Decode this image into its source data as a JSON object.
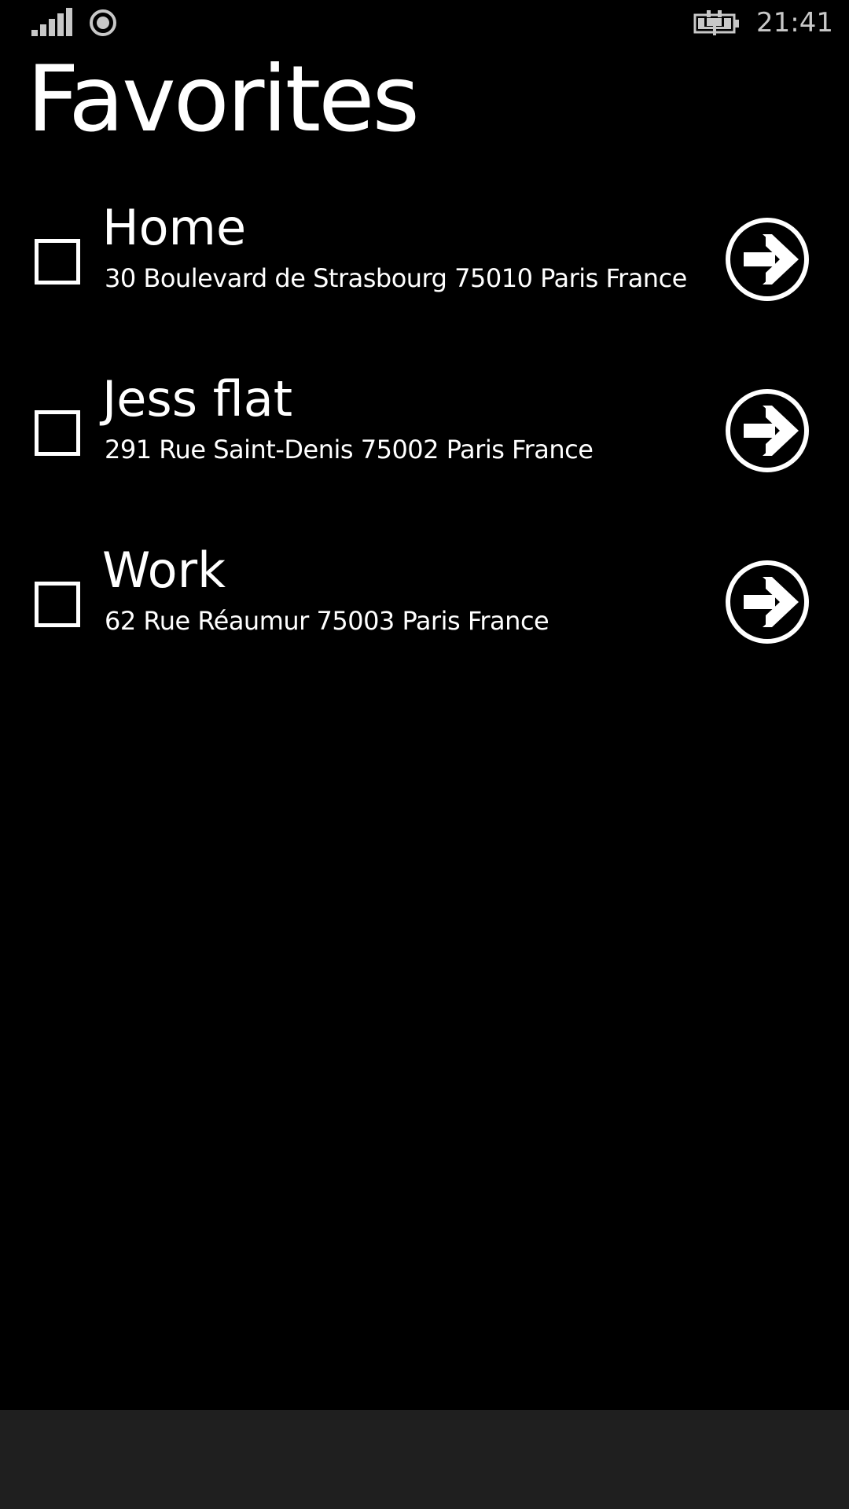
{
  "status_bar": {
    "time": "21:41",
    "signal_icon": "signal-bars-icon",
    "location_icon": "location-icon",
    "battery_icon": "battery-charging-icon",
    "text_color": "#c8c8c8"
  },
  "page": {
    "title": "Favorites",
    "background": "#000000",
    "foreground": "#ffffff"
  },
  "favorites": [
    {
      "name": "Home",
      "address": "30 Boulevard de Strasbourg 75010 Paris France",
      "checked": false,
      "action_icon": "arrow-right-circle-icon"
    },
    {
      "name": "Jess flat",
      "address": "291 Rue Saint-Denis 75002 Paris France",
      "checked": false,
      "action_icon": "arrow-right-circle-icon"
    },
    {
      "name": "Work",
      "address": "62 Rue Réaumur 75003 Paris France",
      "checked": false,
      "action_icon": "arrow-right-circle-icon"
    }
  ],
  "app_bar": {
    "background": "#1f1f1f"
  }
}
